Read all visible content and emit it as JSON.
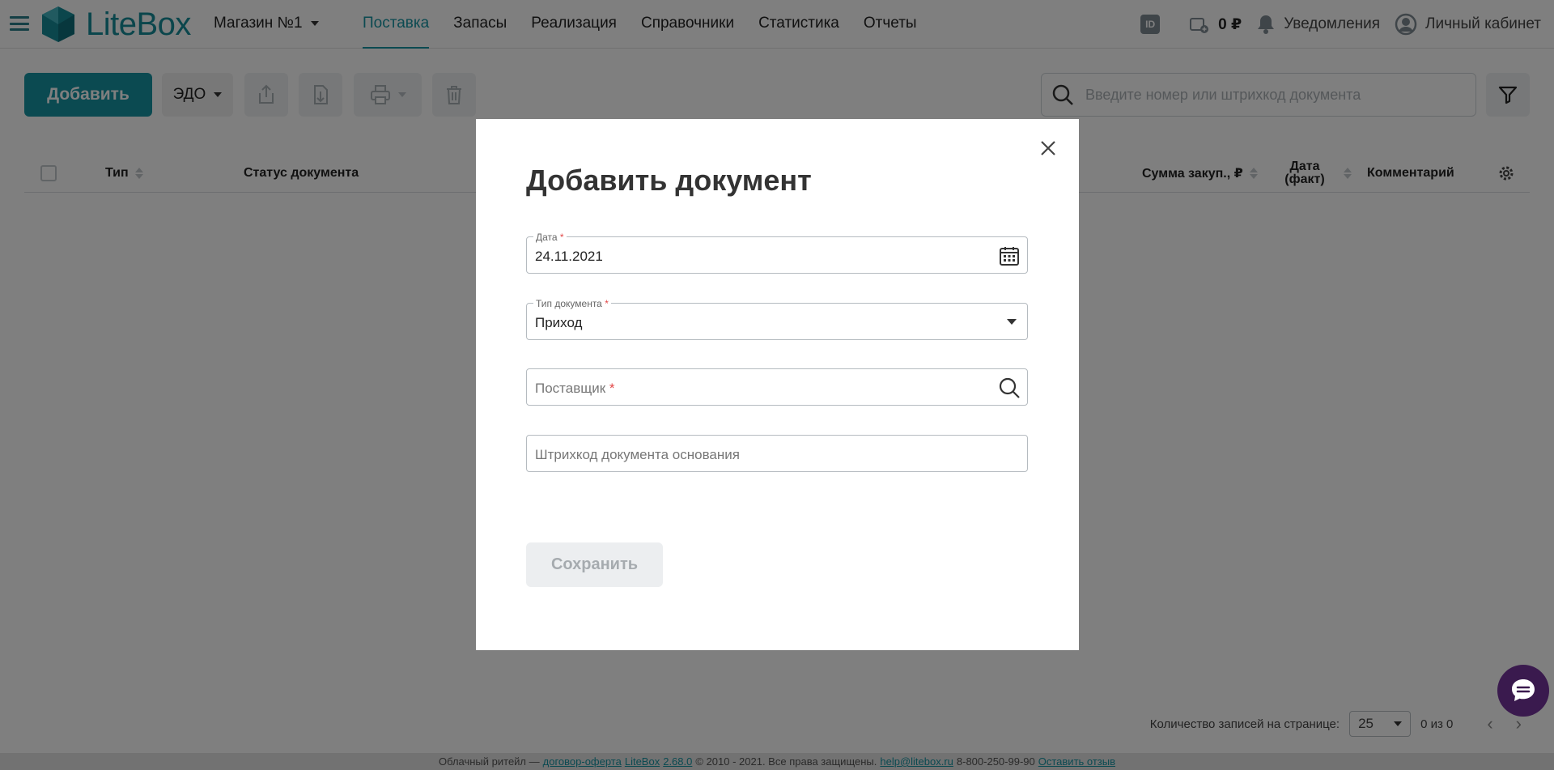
{
  "header": {
    "logo_text": "LiteBox",
    "store_name": "Магазин №1",
    "nav": [
      {
        "label": "Поставка",
        "active": true
      },
      {
        "label": "Запасы",
        "active": false
      },
      {
        "label": "Реализация",
        "active": false
      },
      {
        "label": "Справочники",
        "active": false
      },
      {
        "label": "Статистика",
        "active": false
      },
      {
        "label": "Отчеты",
        "active": false
      }
    ],
    "id_badge": "ID",
    "balance": "0 ₽",
    "notifications": "Уведомления",
    "account": "Личный кабинет"
  },
  "toolbar": {
    "add_label": "Добавить",
    "edo_label": "ЭДО",
    "search_placeholder": "Введите номер или штрихкод документа"
  },
  "table": {
    "columns": [
      "Тип",
      "Статус документа",
      "Сумма закуп., ₽",
      "Дата (факт)",
      "Комментарий"
    ]
  },
  "pagination": {
    "per_page_label": "Количество записей на странице:",
    "per_page_value": "25",
    "range": "0 из 0"
  },
  "footer": {
    "prefix": "Облачный ритейл —",
    "offer_link": "договор-оферта",
    "brand_link": "LiteBox",
    "version_link": "2.68.0",
    "copyright": "© 2010 - 2021. Все права защищены.",
    "email_link": "help@litebox.ru",
    "phone": "8-800-250-99-90",
    "feedback_link": "Оставить отзыв"
  },
  "modal": {
    "title": "Добавить документ",
    "date_label": "Дата",
    "date_value": "24.11.2021",
    "doc_type_label": "Тип документа",
    "doc_type_value": "Приход",
    "supplier_placeholder": "Поставщик",
    "barcode_placeholder": "Штрихкод документа основания",
    "required_mark": "*",
    "save_label": "Сохранить"
  },
  "colors": {
    "accent": "#1794a3",
    "overlay": "rgba(0,0,0,0.5)",
    "required": "#e24848",
    "chat": "#3a1a4e"
  }
}
